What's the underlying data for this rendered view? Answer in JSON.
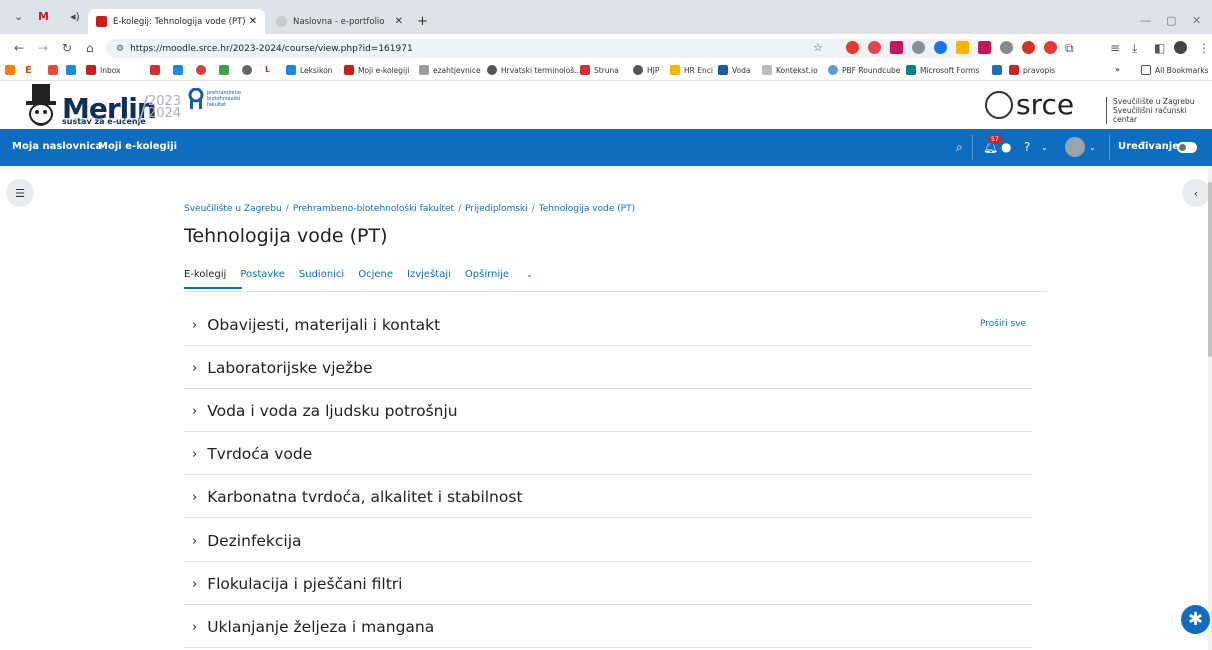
{
  "browser": {
    "tabs": [
      {
        "title": "E-kolegij: Tehnologija vode (PT)",
        "active": true
      },
      {
        "title": "Naslovna - e-portfolio",
        "active": false
      }
    ],
    "url": "https://moodle.srce.hr/2023-2024/course/view.php?id=161971",
    "bookmarks": [
      "Inbox",
      "Leksikon",
      "Moji e-kolegiji",
      "ezahtjevnice",
      "Hrvatski terminološ...",
      "Struna",
      "HJP",
      "HR Enci",
      "Voda",
      "Kontekst.io",
      "PBF Roundcube",
      "Microsoft Forms",
      "pravopis"
    ],
    "all_bookmarks": "All Bookmarks"
  },
  "brand": {
    "merlin": "Merlin",
    "merlin_sub": "sustav za e-učenje",
    "year_top": "2023",
    "year_bottom": "2024",
    "pbf": "prehrambeno biotehnološki fakultet",
    "srce": "srce",
    "srce_line1": "Sveučilište u Zagrebu",
    "srce_line2": "Sveučilišni računski centar"
  },
  "navbar": {
    "home": "Moja naslovnica",
    "courses": "Moji e-kolegiji",
    "notif_count": "57",
    "edit": "Uređivanje"
  },
  "breadcrumb": [
    "Sveučilište u Zagrebu",
    "Prehrambeno-biotehnološki fakultet",
    "Prijediplomski",
    "Tehnologija vode (PT)"
  ],
  "page_title": "Tehnologija vode (PT)",
  "course_tabs": [
    "E-kolegij",
    "Postavke",
    "Sudionici",
    "Ocjene",
    "Izvještaji",
    "Opširnije"
  ],
  "expand_all": "Proširi sve",
  "sections": [
    "Obavijesti, materijali i kontakt",
    "Laboratorijske vježbe",
    "Voda i voda za ljudsku potrošnju",
    "Tvrdoća vode",
    "Karbonatna tvrdoća, alkalitet i stabilnost",
    "Dezinfekcija",
    "Flokulacija i pješčani filtri",
    "Uklanjanje željeza i mangana"
  ]
}
